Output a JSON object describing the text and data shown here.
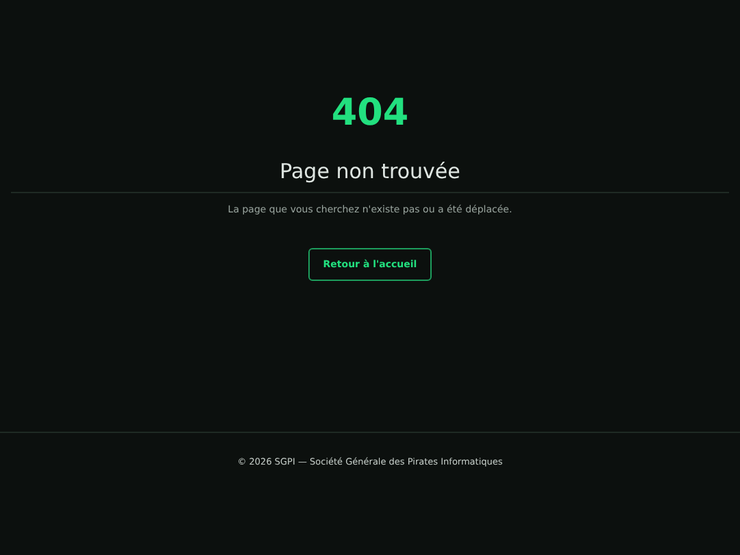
{
  "error": {
    "code": "404",
    "title": "Page non trouvée",
    "message": "La page que vous cherchez n'existe pas ou a été déplacée.",
    "button": "Retour à l'accueil"
  },
  "footer": {
    "text": "© 2026 SGPI — Société Générale des Pirates Informatiques"
  }
}
